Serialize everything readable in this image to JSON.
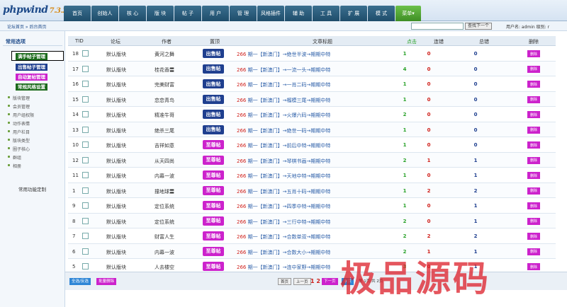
{
  "logo": {
    "brand": "phpwind",
    "version": "7.3.2"
  },
  "nav": [
    "首页",
    "创始人",
    "核 心",
    "版 块",
    "帖 子",
    "用 户",
    "管 理",
    "风格插件",
    "辅 助",
    "工 具",
    "扩 展",
    "模 式",
    "菜单▾"
  ],
  "breadcrumb": "论坛首页 » 后台首页",
  "search": {
    "button": "查找下一个",
    "user": "用户名: admin",
    "level": "级别: r"
  },
  "sidebar": {
    "title": "常用选项",
    "pills": [
      {
        "label": "满手帖子管理",
        "color": "#1c6b1c"
      },
      {
        "label": "出售帖子管理",
        "color": "#1f3f8f"
      },
      {
        "label": "自动复帖管理",
        "color": "#cc22cc"
      },
      {
        "label": "常规风格设置",
        "color": "#1c6b1c"
      }
    ],
    "items": [
      "版块管理",
      "会员管理",
      "用户组权限",
      "动作表情",
      "用户栏目",
      "版块类型",
      "圈子核心",
      "群组",
      "相册"
    ],
    "custom": "常用功能定制"
  },
  "table": {
    "headers": [
      "TID",
      "论坛",
      "作者",
      "置顶",
      "文章标题",
      "点击",
      "连错",
      "总错",
      "删除"
    ],
    "rows": [
      {
        "tid": "18",
        "forum": "默认版块",
        "author": "黄河之舞",
        "badge": "出售帖",
        "badge_type": "sale",
        "num": "266",
        "title": "期一【新澳门】→绝世半波→期期中特",
        "clicks": "1",
        "errs": "0",
        "total": "0"
      },
      {
        "tid": "17",
        "forum": "默认版块",
        "author": "桂花香〓",
        "badge": "出售帖",
        "badge_type": "sale",
        "num": "266",
        "title": "期一【新澳门】→一流一头→期期中特",
        "clicks": "4",
        "errs": "0",
        "total": "0"
      },
      {
        "tid": "16",
        "forum": "默认版块",
        "author": "完美财富",
        "badge": "出售帖",
        "badge_type": "sale",
        "num": "266",
        "title": "期一【新澳门】→一肖二码→期期中特",
        "clicks": "1",
        "errs": "0",
        "total": "0"
      },
      {
        "tid": "15",
        "forum": "默认版块",
        "author": "恋恋青鸟",
        "badge": "出售帖",
        "badge_type": "sale",
        "num": "266",
        "title": "期一【新澳门】→榴模三尾→期期中特",
        "clicks": "1",
        "errs": "0",
        "total": "0"
      },
      {
        "tid": "14",
        "forum": "默认版块",
        "author": "精准牛哥",
        "badge": "出售帖",
        "badge_type": "sale",
        "num": "266",
        "title": "期一【新澳门】→火爆六码→期期中特",
        "clicks": "2",
        "errs": "0",
        "total": "0"
      },
      {
        "tid": "13",
        "forum": "默认版块",
        "author": "绝杀三尾",
        "badge": "出售帖",
        "badge_type": "sale",
        "num": "266",
        "title": "期一【新澳门】→绝世一码→期期中特",
        "clicks": "1",
        "errs": "0",
        "total": "0"
      },
      {
        "tid": "10",
        "forum": "默认版块",
        "author": "吉祥如意",
        "badge": "至尊帖",
        "badge_type": "vip",
        "num": "266",
        "title": "期一【新澳门】→前后中特→期期中特",
        "clicks": "1",
        "errs": "0",
        "total": "0"
      },
      {
        "tid": "12",
        "forum": "默认版块",
        "author": "从天四尚",
        "badge": "至尊帖",
        "badge_type": "vip",
        "num": "266",
        "title": "期一【新澳门】→琴棋书画→期期中特",
        "clicks": "2",
        "errs": "1",
        "total": "1"
      },
      {
        "tid": "11",
        "forum": "默认版块",
        "author": "内幕一波",
        "badge": "至尊帖",
        "badge_type": "vip",
        "num": "266",
        "title": "期一【新澳门】→天地中特→期期中特",
        "clicks": "1",
        "errs": "0",
        "total": "1"
      },
      {
        "tid": "1",
        "forum": "默认版块",
        "author": "撞地球〓",
        "badge": "至尊帖",
        "badge_type": "vip",
        "num": "266",
        "title": "期一【新澳门】→五肖十码→期期中特",
        "clicks": "1",
        "errs": "2",
        "total": "2"
      },
      {
        "tid": "9",
        "forum": "默认版块",
        "author": "定位系统",
        "badge": "至尊帖",
        "badge_type": "vip",
        "num": "266",
        "title": "期一【新澳门】→四季中特→期期中特",
        "clicks": "1",
        "errs": "0",
        "total": "1"
      },
      {
        "tid": "8",
        "forum": "默认版块",
        "author": "定位系统",
        "badge": "至尊帖",
        "badge_type": "vip",
        "num": "266",
        "title": "期一【新澳门】→三行中特→期期中特",
        "clicks": "2",
        "errs": "0",
        "total": "1"
      },
      {
        "tid": "7",
        "forum": "默认版块",
        "author": "财富人生",
        "badge": "至尊帖",
        "badge_type": "vip",
        "num": "266",
        "title": "期一【新澳门】→合数单双→期期中特",
        "clicks": "2",
        "errs": "2",
        "total": "2"
      },
      {
        "tid": "6",
        "forum": "默认版块",
        "author": "内幕一波",
        "badge": "至尊帖",
        "badge_type": "vip",
        "num": "266",
        "title": "期一【新澳门】→合数大小→期期中特",
        "clicks": "2",
        "errs": "1",
        "total": "1"
      },
      {
        "tid": "5",
        "forum": "默认版块",
        "author": "人去楼空",
        "badge": "至尊帖",
        "badge_type": "vip",
        "num": "266",
        "title": "期一【新澳门】→连中家野→期期中特",
        "clicks": "3",
        "errs": "0",
        "total": "1"
      }
    ],
    "delete_label": "删除"
  },
  "footer": {
    "select_all": "全选/反选",
    "bulk_delete": "批量删除",
    "first": "首页",
    "prev": "上一页",
    "pages": "1 2",
    "next": "下一页",
    "last": "末页",
    "page_info": "第 1页/共 2页"
  },
  "watermark": "极品源码",
  "colors": {
    "nav_active": "#4a9e2f",
    "sale_badge": "#1f3f8f",
    "vip_badge": "#cc22cc",
    "red": "#d0201b",
    "blue": "#2b5ea8",
    "green": "#2aa22a"
  }
}
